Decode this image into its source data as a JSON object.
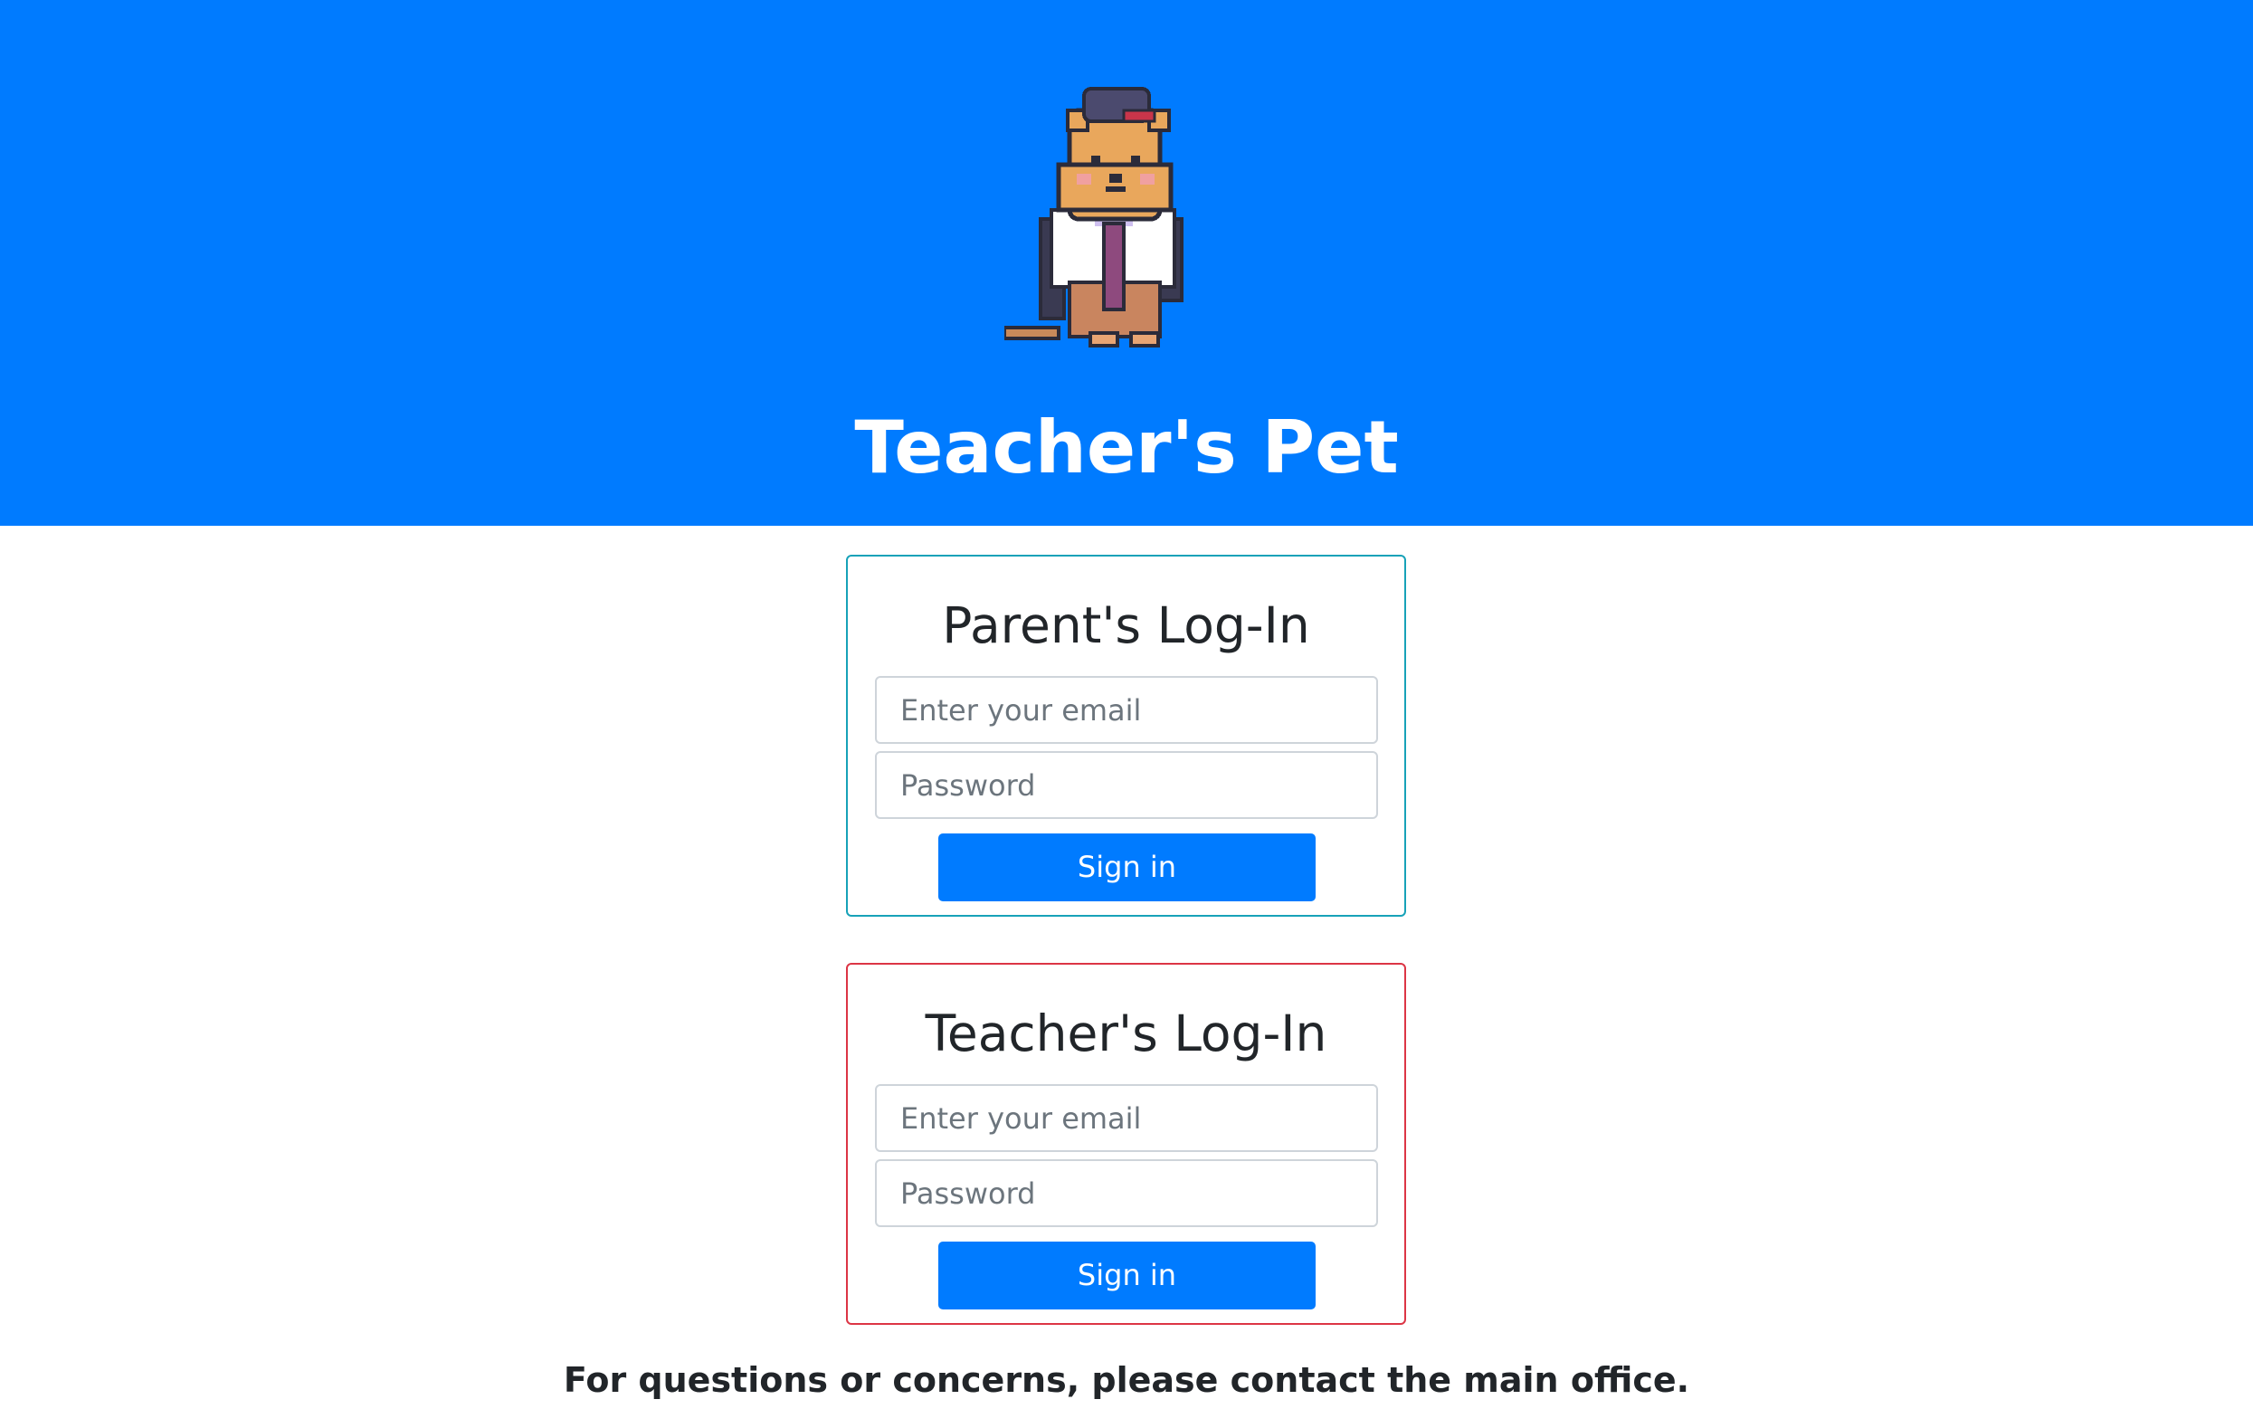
{
  "header": {
    "title": "Teacher's Pet",
    "background_color": "#007bff",
    "mascot": "hamster-mascot-with-cap-and-tie"
  },
  "parent_login": {
    "title": "Parent's Log-In",
    "email_placeholder": "Enter your email",
    "password_placeholder": "Password",
    "submit_label": "Sign in",
    "border_color": "#17a2b8"
  },
  "teacher_login": {
    "title": "Teacher's Log-In",
    "email_placeholder": "Enter your email",
    "password_placeholder": "Password",
    "submit_label": "Sign in",
    "border_color": "#dc3545"
  },
  "footer": {
    "note": "For questions or concerns, please contact the main office."
  }
}
